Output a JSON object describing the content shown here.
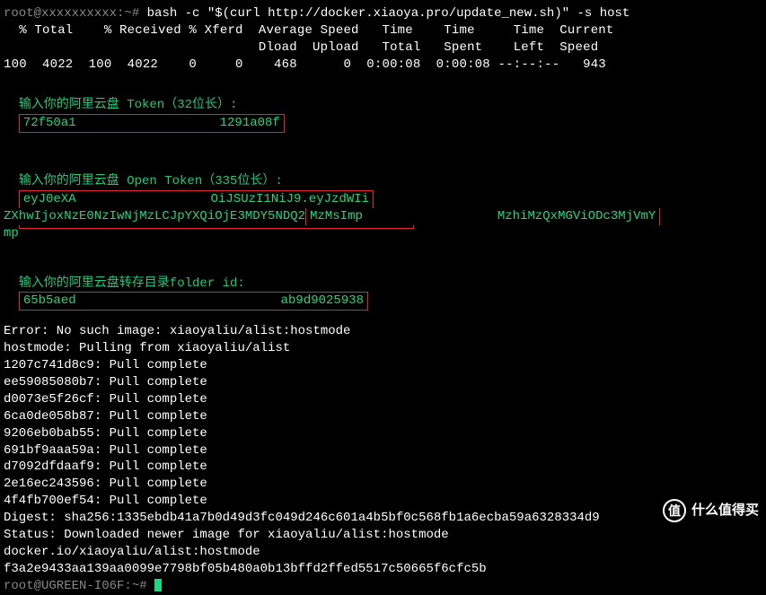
{
  "cmd": {
    "prompt": "root@xxxxxxxxxx:~#",
    "command": "bash -c \"$(curl http://docker.xiaoya.pro/update_new.sh)\" -s host"
  },
  "curl": {
    "header1": "  % Total    % Received % Xferd  Average Speed   Time    Time     Time  Current",
    "header2": "                                 Dload  Upload   Total   Spent    Left  Speed",
    "row": "100  4022  100  4022    0     0    468      0  0:00:08  0:00:08 --:--:--   943"
  },
  "prompts": {
    "token_label": "输入你的阿里云盘 Token（32位长）:",
    "token_value_pre": "72f50a1",
    "token_value_post": "1291a08f",
    "open_label": "输入你的阿里云盘 Open Token（335位长）:",
    "open_value_l1_pre": "eyJ0eXA",
    "open_value_l1_post": "OiJSUzI1NiJ9.eyJzdWIi",
    "open_value_l2_pre": "ZXhwIjoxNzE0NzIwNjMzLCJpYXQiOjE3MDY5NDQ2",
    "open_value_l2_mid": "MzMsImp",
    "open_value_l2_post": "MzhiMzQxMGViODc3MjVmY",
    "open_value_l3": "mp",
    "folder_label": "输入你的阿里云盘转存目录folder id:",
    "folder_value_pre": "65b5aed",
    "folder_value_post": "ab9d9025938"
  },
  "docker": {
    "error": "Error: No such image: xiaoyaliu/alist:hostmode",
    "pulling": "hostmode: Pulling from xiaoyaliu/alist",
    "layers": [
      "1207c741d8c9: Pull complete",
      "ee59085080b7: Pull complete",
      "d0073e5f26cf: Pull complete",
      "6ca0de058b87: Pull complete",
      "9206eb0bab55: Pull complete",
      "691bf9aaa59a: Pull complete",
      "d7092dfdaaf9: Pull complete",
      "2e16ec243596: Pull complete",
      "4f4fb700ef54: Pull complete"
    ],
    "digest": "Digest: sha256:1335ebdb41a7b0d49d3fc049d246c601a4b5bf0c568fb1a6ecba59a6328334d9",
    "status": "Status: Downloaded newer image for xiaoyaliu/alist:hostmode",
    "image": "docker.io/xiaoyaliu/alist:hostmode",
    "container": "f3a2e9433aa139aa0099e7798bf05b480a0b13bffd2ffed5517c50665f6cfc5b",
    "last_prompt": "root@UGREEN-I06F:~#"
  },
  "watermark": {
    "badge": "值",
    "text": "什么值得买"
  }
}
